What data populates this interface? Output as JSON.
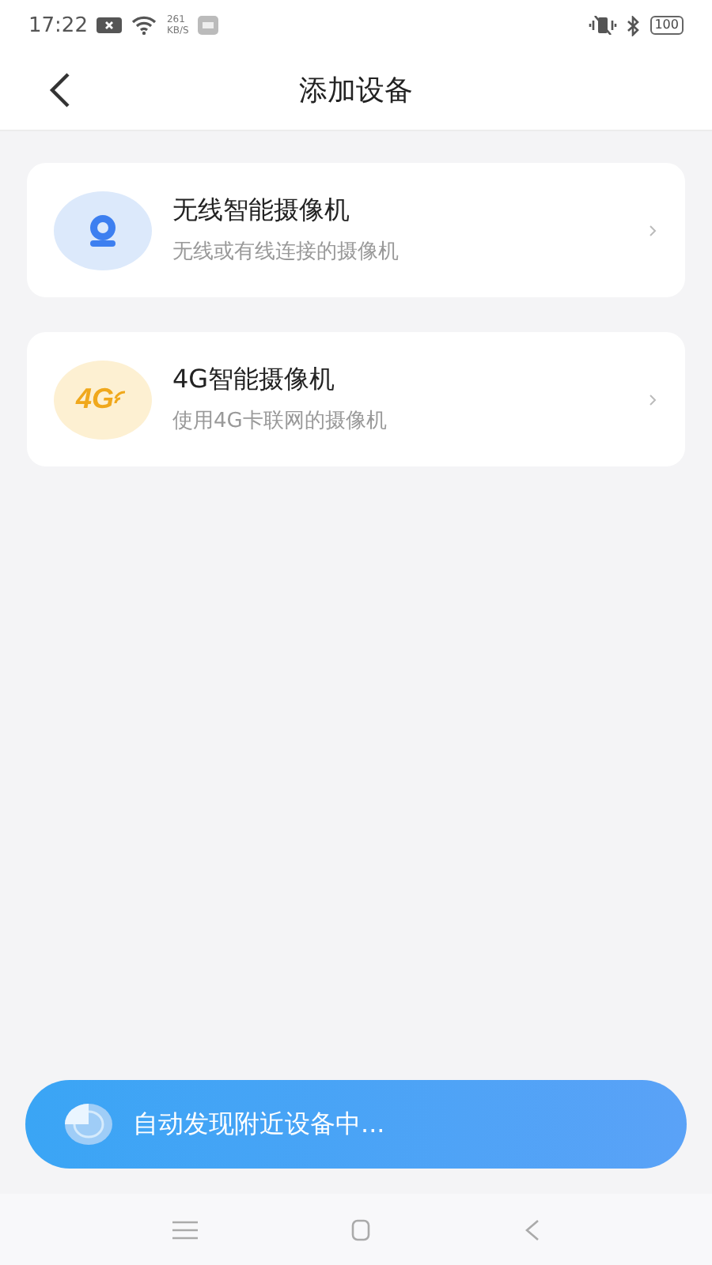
{
  "status_bar": {
    "time": "17:22",
    "net_speed": "261",
    "net_speed_unit": "KB/S",
    "battery": "100"
  },
  "header": {
    "title": "添加设备"
  },
  "devices": [
    {
      "kind": "wifi",
      "title": "无线智能摄像机",
      "subtitle": "无线或有线连接的摄像机"
    },
    {
      "kind": "cellular",
      "icon_text": "4G",
      "title": "4G智能摄像机",
      "subtitle": "使用4G卡联网的摄像机"
    }
  ],
  "scan_banner": {
    "text": "自动发现附近设备中..."
  }
}
